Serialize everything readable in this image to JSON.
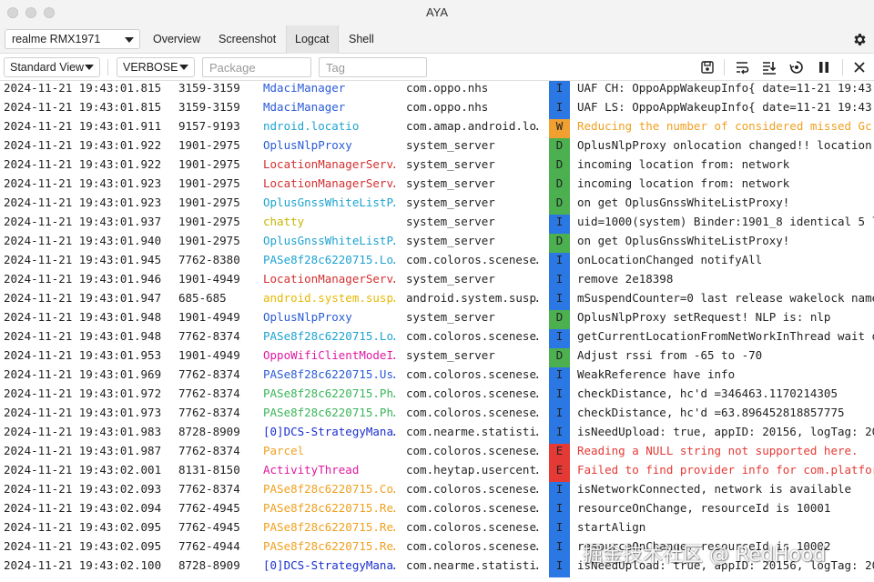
{
  "app": {
    "title": "AYA"
  },
  "nav": {
    "device": "realme RMX1971",
    "tabs": [
      {
        "label": "Overview",
        "active": false
      },
      {
        "label": "Screenshot",
        "active": false
      },
      {
        "label": "Logcat",
        "active": true
      },
      {
        "label": "Shell",
        "active": false
      }
    ],
    "settings_icon": "gear-icon"
  },
  "toolbar": {
    "view_mode": "Standard View",
    "log_level": "VERBOSE",
    "package_placeholder": "Package",
    "tag_placeholder": "Tag",
    "icons": [
      "save-icon",
      "wrap-lines-icon",
      "scroll-to-end-icon",
      "restart-icon",
      "pause-icon",
      "clear-icon"
    ]
  },
  "colors": {
    "level_I": "#2b78e4",
    "level_D": "#4caf50",
    "level_W": "#f0a030",
    "level_E": "#e53935",
    "tag_blue": "#2a5bd7",
    "tag_red": "#d32f2f",
    "tag_cyan": "#1ea3d0",
    "tag_green": "#3bb55a",
    "tag_yellow": "#c8b400",
    "tag_orange": "#f0a020",
    "tag_magenta": "#e01aa0",
    "tag_navy": "#1a2fcc"
  },
  "log": {
    "rows": [
      {
        "time": "2024-11-21 19:43:01.815",
        "pid": "3159-3159",
        "tag": "MdaciManager",
        "tag_color": "#2a5bd7",
        "package": "com.oppo.nhs",
        "level": "I",
        "message": "UAF CH: OppoAppWakeupInfo{ date=11-21 19:43:",
        "msg_color": "#222222"
      },
      {
        "time": "2024-11-21 19:43:01.815",
        "pid": "3159-3159",
        "tag": "MdaciManager",
        "tag_color": "#2a5bd7",
        "package": "com.oppo.nhs",
        "level": "I",
        "message": "UAF LS: OppoAppWakeupInfo{ date=11-21 19:43:",
        "msg_color": "#222222"
      },
      {
        "time": "2024-11-21 19:43:01.911",
        "pid": "9157-9193",
        "tag": "ndroid.locatio",
        "tag_color": "#1ea3d0",
        "package": "com.amap.android.lo…",
        "level": "W",
        "message": "Reducing the number of considered missed Gc",
        "msg_color": "#f0a020"
      },
      {
        "time": "2024-11-21 19:43:01.922",
        "pid": "1901-2975",
        "tag": "OplusNlpProxy",
        "tag_color": "#2a5bd7",
        "package": "system_server",
        "level": "D",
        "message": "OplusNlpProxy onlocation changed!! location:",
        "msg_color": "#222222"
      },
      {
        "time": "2024-11-21 19:43:01.922",
        "pid": "1901-2975",
        "tag": "LocationManagerServ…",
        "tag_color": "#d32f2f",
        "package": "system_server",
        "level": "D",
        "message": "incoming location from: network",
        "msg_color": "#222222"
      },
      {
        "time": "2024-11-21 19:43:01.923",
        "pid": "1901-2975",
        "tag": "LocationManagerServ…",
        "tag_color": "#d32f2f",
        "package": "system_server",
        "level": "D",
        "message": "incoming location from: network",
        "msg_color": "#222222"
      },
      {
        "time": "2024-11-21 19:43:01.923",
        "pid": "1901-2975",
        "tag": "OplusGnssWhiteListP…",
        "tag_color": "#1ea3d0",
        "package": "system_server",
        "level": "D",
        "message": "on get OplusGnssWhiteListProxy!",
        "msg_color": "#222222"
      },
      {
        "time": "2024-11-21 19:43:01.937",
        "pid": "1901-2975",
        "tag": "chatty",
        "tag_color": "#c8b400",
        "package": "system_server",
        "level": "I",
        "message": "uid=1000(system) Binder:1901_8 identical 5 l",
        "msg_color": "#222222"
      },
      {
        "time": "2024-11-21 19:43:01.940",
        "pid": "1901-2975",
        "tag": "OplusGnssWhiteListP…",
        "tag_color": "#1ea3d0",
        "package": "system_server",
        "level": "D",
        "message": "on get OplusGnssWhiteListProxy!",
        "msg_color": "#222222"
      },
      {
        "time": "2024-11-21 19:43:01.945",
        "pid": "7762-8380",
        "tag": "PASe8f28c6220715.Lo…",
        "tag_color": "#1ea3d0",
        "package": "com.coloros.scenese…",
        "level": "I",
        "message": "onLocationChanged notifyAll",
        "msg_color": "#222222"
      },
      {
        "time": "2024-11-21 19:43:01.946",
        "pid": "1901-4949",
        "tag": "LocationManagerServ…",
        "tag_color": "#d32f2f",
        "package": "system_server",
        "level": "I",
        "message": "remove 2e18398",
        "msg_color": "#222222"
      },
      {
        "time": "2024-11-21 19:43:01.947",
        "pid": "685-685",
        "tag": "android.system.susp…",
        "tag_color": "#e6b800",
        "package": "android.system.susp…",
        "level": "I",
        "message": "mSuspendCounter=0 last release wakelock name",
        "msg_color": "#222222"
      },
      {
        "time": "2024-11-21 19:43:01.948",
        "pid": "1901-4949",
        "tag": "OplusNlpProxy",
        "tag_color": "#2a5bd7",
        "package": "system_server",
        "level": "D",
        "message": "OplusNlpProxy setRequest! NLP is: nlp",
        "msg_color": "#222222"
      },
      {
        "time": "2024-11-21 19:43:01.948",
        "pid": "7762-8374",
        "tag": "PASe8f28c6220715.Lo…",
        "tag_color": "#1ea3d0",
        "package": "com.coloros.scenese…",
        "level": "I",
        "message": "getCurrentLocationFromNetWorkInThread wait o",
        "msg_color": "#222222"
      },
      {
        "time": "2024-11-21 19:43:01.953",
        "pid": "1901-4949",
        "tag": "OppoWifiClientModeI…",
        "tag_color": "#e01aa0",
        "package": "system_server",
        "level": "D",
        "message": "Adjust rssi from -65 to -70",
        "msg_color": "#222222"
      },
      {
        "time": "2024-11-21 19:43:01.969",
        "pid": "7762-8374",
        "tag": "PASe8f28c6220715.Us…",
        "tag_color": "#2a5bd7",
        "package": "com.coloros.scenese…",
        "level": "I",
        "message": "WeakReference have info",
        "msg_color": "#222222"
      },
      {
        "time": "2024-11-21 19:43:01.972",
        "pid": "7762-8374",
        "tag": "PASe8f28c6220715.Ph…",
        "tag_color": "#3bb55a",
        "package": "com.coloros.scenese…",
        "level": "I",
        "message": "checkDistance, hc'd =346463.1170214305",
        "msg_color": "#222222"
      },
      {
        "time": "2024-11-21 19:43:01.973",
        "pid": "7762-8374",
        "tag": "PASe8f28c6220715.Ph…",
        "tag_color": "#3bb55a",
        "package": "com.coloros.scenese…",
        "level": "I",
        "message": "checkDistance, hc'd =63.896452818857775",
        "msg_color": "#222222"
      },
      {
        "time": "2024-11-21 19:43:01.983",
        "pid": "8728-8909",
        "tag": "[0]DCS-StrategyMana…",
        "tag_color": "#1a2fcc",
        "package": "com.nearme.statisti…",
        "level": "I",
        "message": "isNeedUpload: true, appID: 20156, logTag: 20",
        "msg_color": "#222222"
      },
      {
        "time": "2024-11-21 19:43:01.987",
        "pid": "7762-8374",
        "tag": "Parcel",
        "tag_color": "#f0a020",
        "package": "com.coloros.scenese…",
        "level": "E",
        "message": "Reading a NULL string not supported here.",
        "msg_color": "#e53935"
      },
      {
        "time": "2024-11-21 19:43:02.001",
        "pid": "8131-8150",
        "tag": "ActivityThread",
        "tag_color": "#e01aa0",
        "package": "com.heytap.usercent…",
        "level": "E",
        "message": "Failed to find provider info for com.platfor",
        "msg_color": "#e53935"
      },
      {
        "time": "2024-11-21 19:43:02.093",
        "pid": "7762-8374",
        "tag": "PASe8f28c6220715.Co…",
        "tag_color": "#f0a020",
        "package": "com.coloros.scenese…",
        "level": "I",
        "message": "isNetworkConnected, network is available",
        "msg_color": "#222222"
      },
      {
        "time": "2024-11-21 19:43:02.094",
        "pid": "7762-4945",
        "tag": "PASe8f28c6220715.Re…",
        "tag_color": "#f0a020",
        "package": "com.coloros.scenese…",
        "level": "I",
        "message": "resourceOnChange, resourceId is 10001",
        "msg_color": "#222222"
      },
      {
        "time": "2024-11-21 19:43:02.095",
        "pid": "7762-4945",
        "tag": "PASe8f28c6220715.Re…",
        "tag_color": "#f0a020",
        "package": "com.coloros.scenese…",
        "level": "I",
        "message": "startAlign",
        "msg_color": "#222222"
      },
      {
        "time": "2024-11-21 19:43:02.095",
        "pid": "7762-4944",
        "tag": "PASe8f28c6220715.Re…",
        "tag_color": "#f0a020",
        "package": "com.coloros.scenese…",
        "level": "I",
        "message": "resourceOnChange, resourceId is 10002",
        "msg_color": "#222222"
      },
      {
        "time": "2024-11-21 19:43:02.100",
        "pid": "8728-8909",
        "tag": "[0]DCS-StrategyMana…",
        "tag_color": "#1a2fcc",
        "package": "com.nearme.statisti…",
        "level": "I",
        "message": "isNeedUpload: true, appID: 20156, logTag: 20",
        "msg_color": "#222222"
      }
    ]
  },
  "watermark": "掘金技术社区 @ RedHood"
}
